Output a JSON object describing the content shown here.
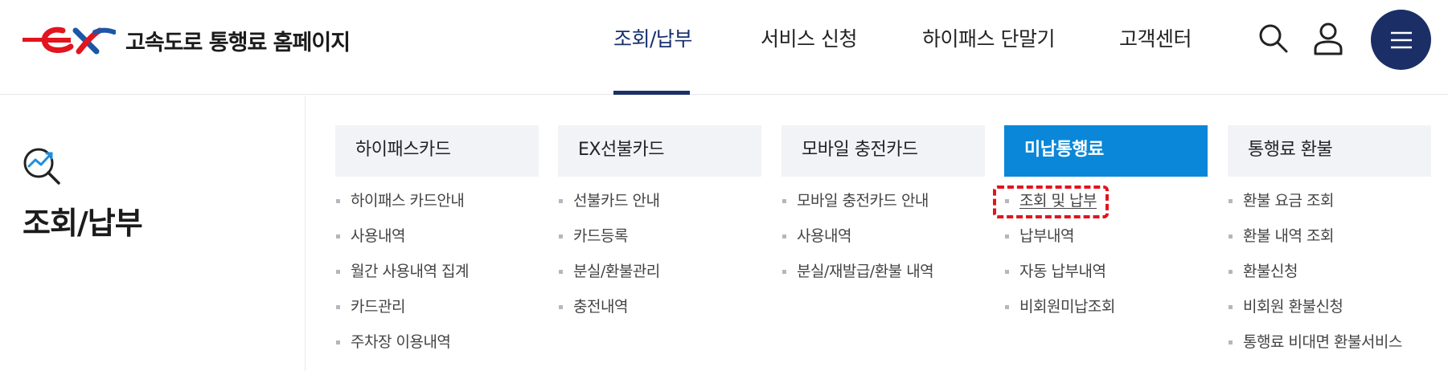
{
  "brand": {
    "name": "고속도로 통행료 홈페이지",
    "logo_text": "ex",
    "colors": {
      "primary_navy": "#1b2f66",
      "logo_red": "#e2141d",
      "logo_blue": "#1d56a6",
      "active_blue": "#0a87d8"
    }
  },
  "nav": {
    "items": [
      {
        "label": "조회/납부",
        "active": true
      },
      {
        "label": "서비스 신청",
        "active": false
      },
      {
        "label": "하이패스 단말기",
        "active": false
      },
      {
        "label": "고객센터",
        "active": false
      }
    ]
  },
  "utility": {
    "search_icon": "search-icon",
    "user_icon": "user-icon",
    "menu_icon": "hamburger-icon"
  },
  "section": {
    "title": "조회/납부",
    "icon": "search-chart-icon"
  },
  "columns": [
    {
      "heading": "하이패스카드",
      "active": false,
      "items": [
        "하이패스 카드안내",
        "사용내역",
        "월간 사용내역 집계",
        "카드관리",
        "주차장 이용내역"
      ]
    },
    {
      "heading": "EX선불카드",
      "active": false,
      "items": [
        "선불카드 안내",
        "카드등록",
        "분실/환불관리",
        "충전내역"
      ]
    },
    {
      "heading": "모바일 충전카드",
      "active": false,
      "items": [
        "모바일 충전카드 안내",
        "사용내역",
        "분실/재발급/환불 내역"
      ]
    },
    {
      "heading": "미납통행료",
      "active": true,
      "items": [
        "조회 및 납부",
        "납부내역",
        "자동 납부내역",
        "비회원미납조회"
      ]
    },
    {
      "heading": "통행료 환불",
      "active": false,
      "items": [
        "환불 요금 조회",
        "환불 내역 조회",
        "환불신청",
        "비회원 환불신청",
        "통행료 비대면 환불서비스"
      ]
    }
  ]
}
